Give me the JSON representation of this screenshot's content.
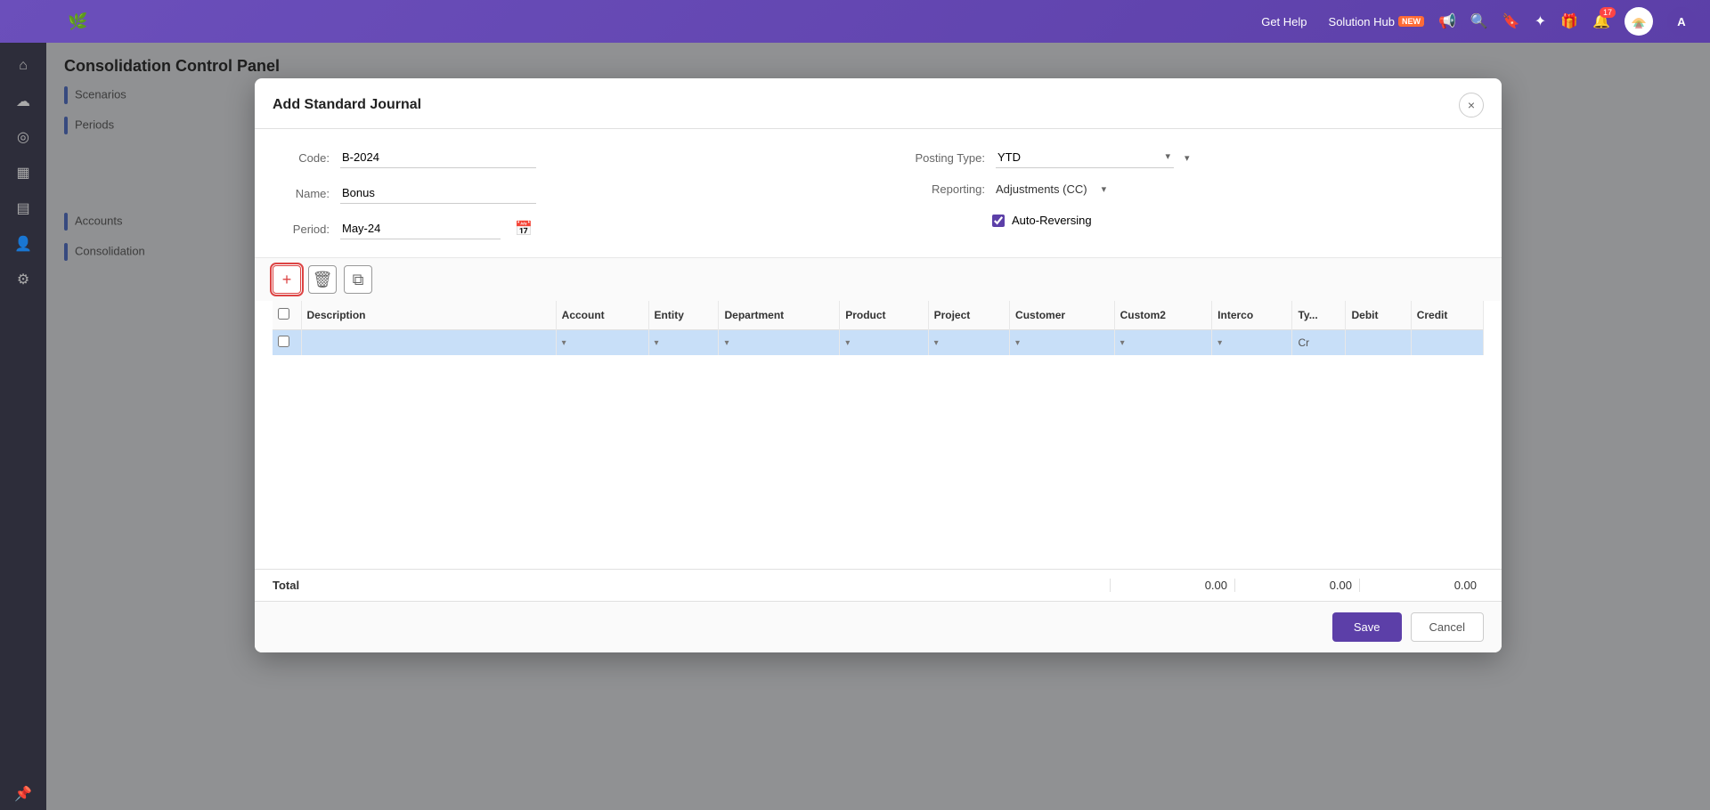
{
  "topnav": {
    "get_help": "Get Help",
    "solution_hub": "Solution Hub",
    "solution_hub_badge": "NEW",
    "notification_count": "17",
    "user_initial": "A"
  },
  "modal": {
    "title": "Add Standard Journal",
    "close_label": "×",
    "form": {
      "code_label": "Code:",
      "code_value": "B-2024",
      "name_label": "Name:",
      "name_value": "Bonus",
      "period_label": "Period:",
      "period_value": "May-24",
      "posting_type_label": "Posting Type:",
      "posting_type_value": "YTD",
      "reporting_label": "Reporting:",
      "reporting_value": "Adjustments (CC)",
      "auto_reversing_label": "Auto-Reversing"
    },
    "table": {
      "columns": [
        "",
        "Description",
        "Account",
        "Entity",
        "Department",
        "Product",
        "Project",
        "Customer",
        "Custom2",
        "Interco",
        "Ty...",
        "Debit",
        "Credit"
      ],
      "total_label": "Total",
      "total_interco": "0.00",
      "total_debit": "0.00",
      "total_credit": "0.00",
      "row_type": "Cr"
    },
    "toolbar": {
      "add_tooltip": "+",
      "delete_tooltip": "🗑",
      "copy_tooltip": "⧉"
    },
    "footer": {
      "save_label": "Save",
      "cancel_label": "Cancel"
    }
  },
  "sidebar": {
    "icons": [
      "⌂",
      "☁",
      "◎",
      "▦",
      "▤",
      "👤",
      "🔧",
      "★"
    ]
  },
  "background": {
    "title": "Consolidation Control Panel",
    "sections": [
      "Scenarios",
      "Periods",
      "Accounts",
      "Consolidation"
    ]
  }
}
